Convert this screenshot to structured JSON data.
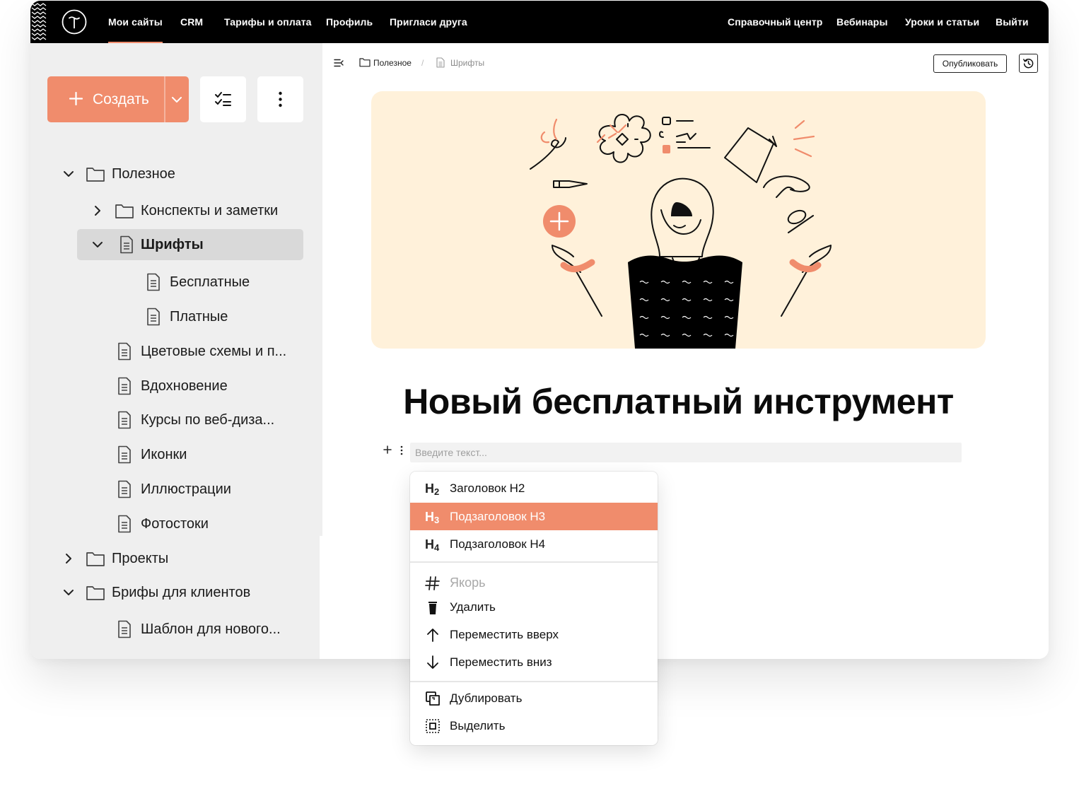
{
  "topnav": {
    "left": [
      "Мои сайты",
      "CRM",
      "Тарифы и оплата",
      "Профиль",
      "Пригласи друга"
    ],
    "right": [
      "Справочный центр",
      "Вебинары",
      "Уроки и статьи",
      "Выйти"
    ]
  },
  "sidebar": {
    "create_label": "Создать",
    "tree": [
      {
        "label": "Полезное",
        "type": "folder",
        "expanded": true
      },
      {
        "label": "Конспекты и заметки",
        "type": "folder",
        "expanded": false
      },
      {
        "label": "Шрифты",
        "type": "page",
        "expanded": true,
        "selected": true
      },
      {
        "label": "Бесплатные",
        "type": "page"
      },
      {
        "label": "Платные",
        "type": "page"
      },
      {
        "label": "Цветовые схемы и п...",
        "type": "page"
      },
      {
        "label": "Вдохновение",
        "type": "page"
      },
      {
        "label": "Курсы по веб-диза...",
        "type": "page"
      },
      {
        "label": "Иконки",
        "type": "page"
      },
      {
        "label": "Иллюстрации",
        "type": "page"
      },
      {
        "label": "Фотостоки",
        "type": "page"
      },
      {
        "label": "Проекты",
        "type": "folder",
        "expanded": false
      },
      {
        "label": "Брифы для клиентов",
        "type": "folder",
        "expanded": true
      },
      {
        "label": "Шаблон для нового...",
        "type": "page"
      }
    ]
  },
  "breadcrumb": {
    "folder": "Полезное",
    "page": "Шрифты",
    "separator": "/"
  },
  "toolbar": {
    "publish_label": "Опубликовать"
  },
  "page": {
    "title": "Новый бесплатный инструмент",
    "input_placeholder": "Введите текст..."
  },
  "menu": {
    "items": [
      {
        "icon": "H2",
        "label": "Заголовок H2"
      },
      {
        "icon": "H3",
        "label": "Подзаголовок H3",
        "active": true
      },
      {
        "icon": "H4",
        "label": "Подзаголовок H4"
      },
      {
        "icon": "anchor-hash-icon",
        "label": "Якорь",
        "disabled": true
      },
      {
        "icon": "trash-icon",
        "label": "Удалить"
      },
      {
        "icon": "arrow-up-icon",
        "label": "Переместить вверх"
      },
      {
        "icon": "arrow-down-icon",
        "label": "Переместить вниз"
      },
      {
        "icon": "duplicate-icon",
        "label": "Дублировать"
      },
      {
        "icon": "select-icon",
        "label": "Выделить"
      }
    ]
  },
  "colors": {
    "accent": "#f08c6c",
    "cover_bg": "#fff1da",
    "sidebar_bg": "#efefef",
    "selected_bg": "#d9d9d9",
    "topbar_bg": "#000000"
  }
}
